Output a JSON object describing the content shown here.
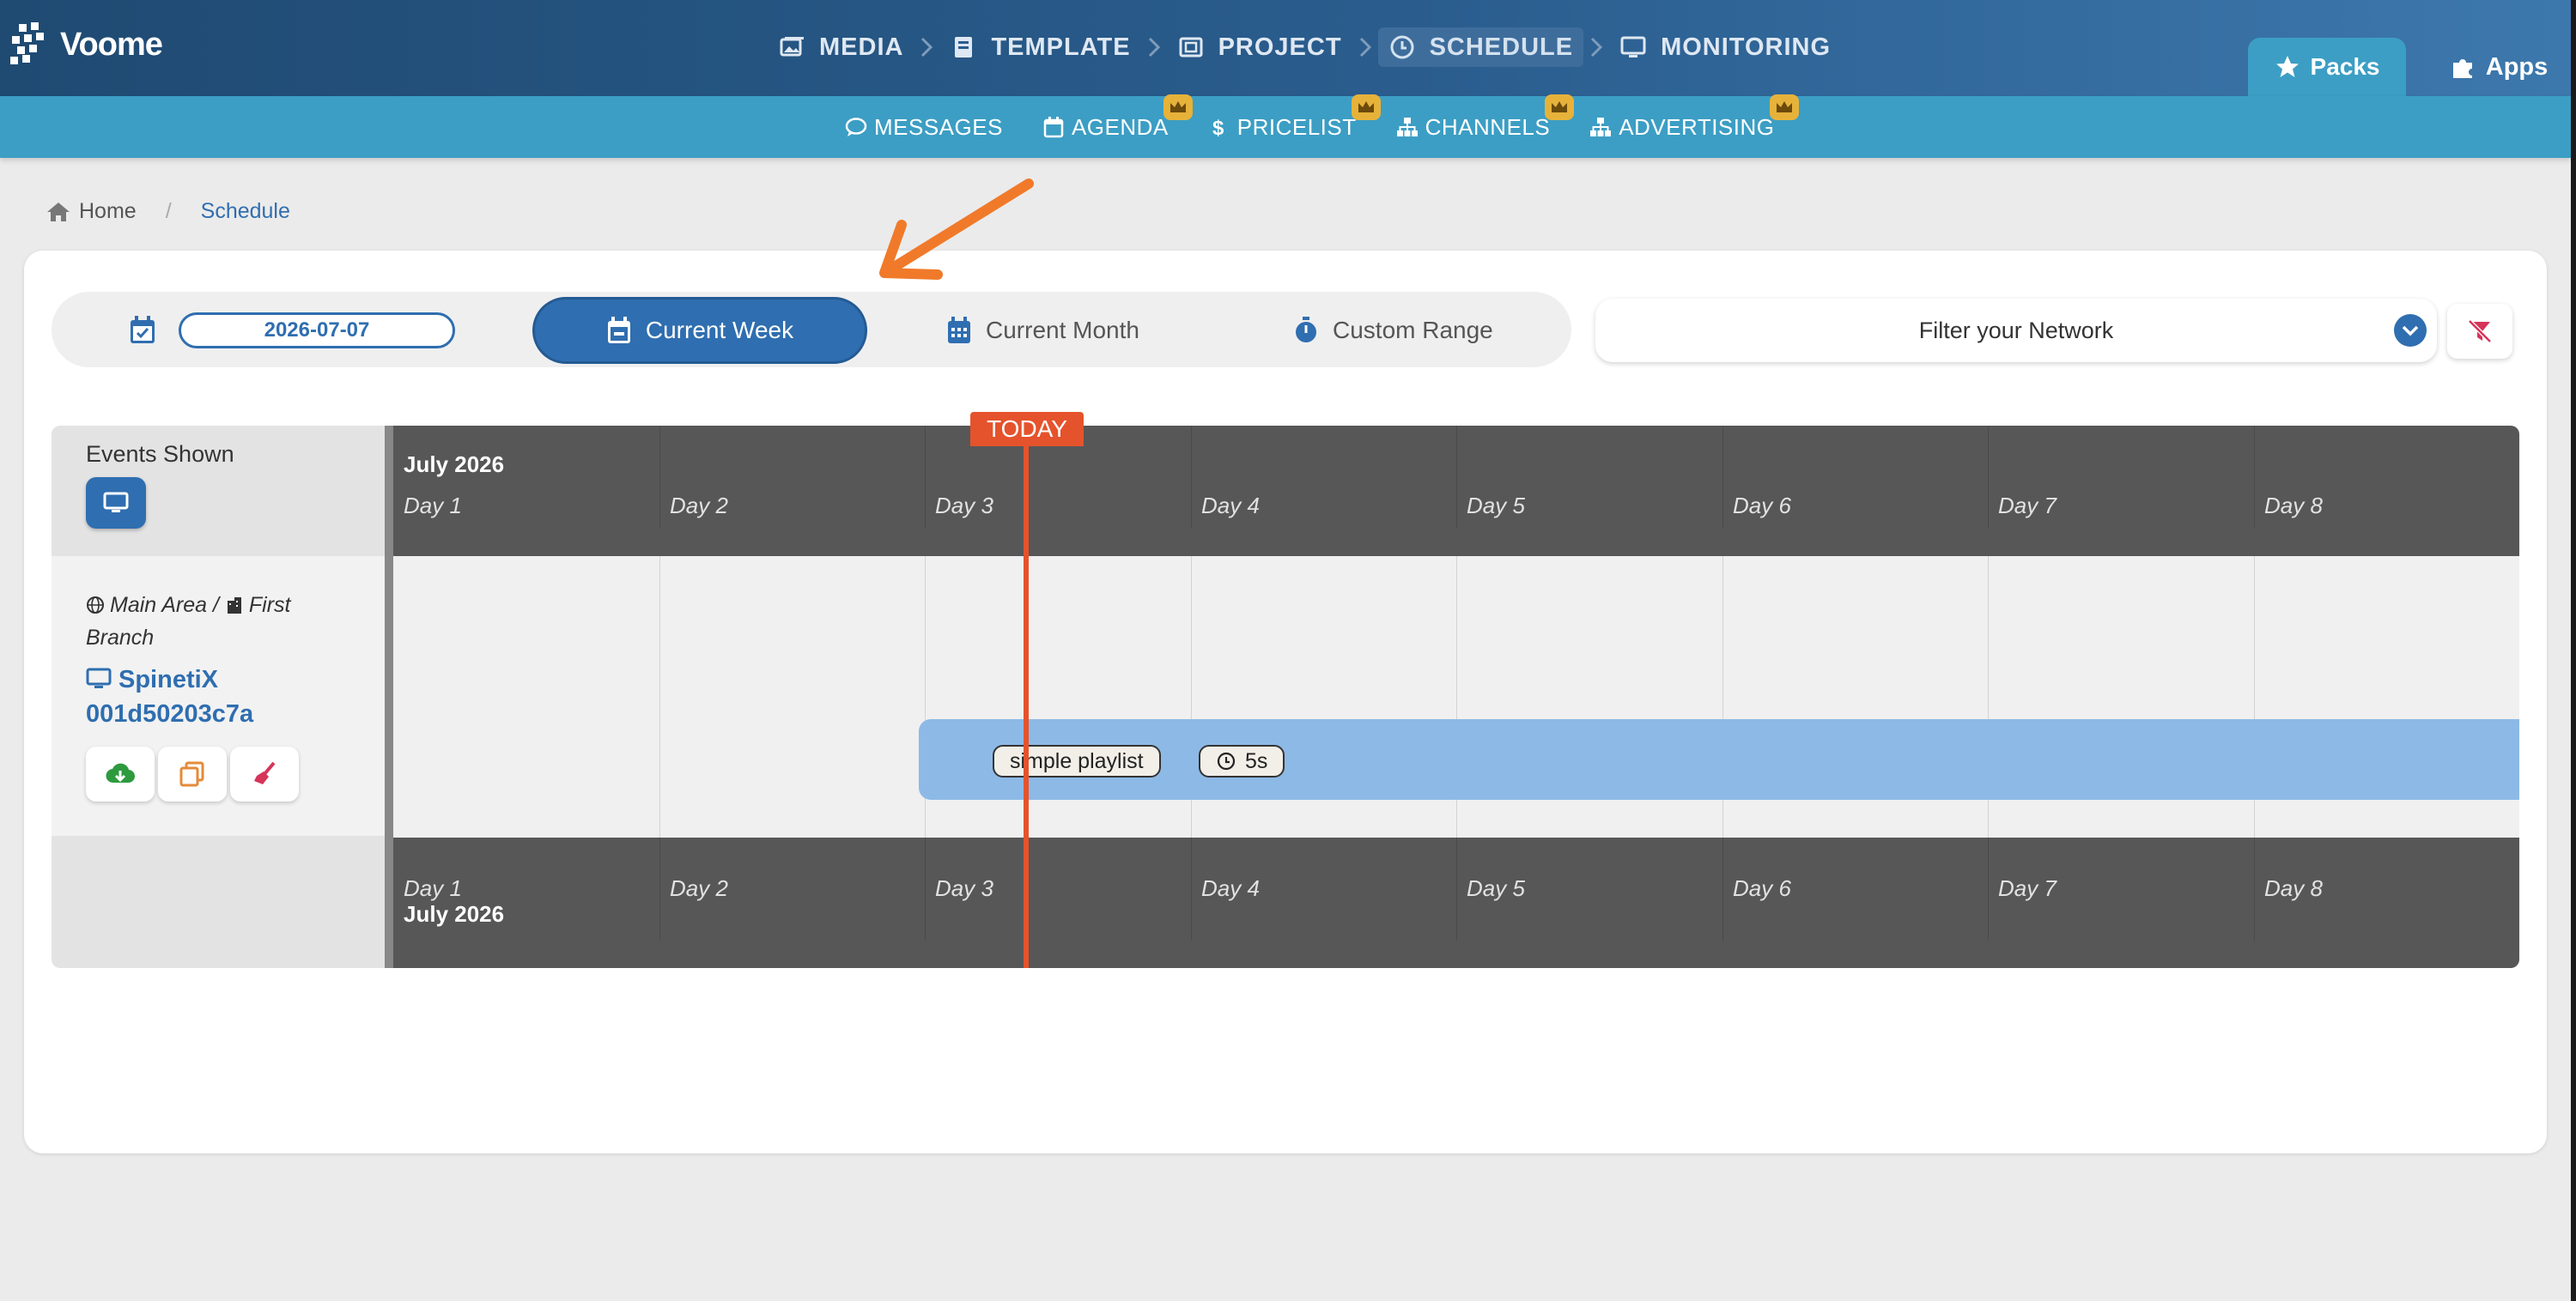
{
  "brand": {
    "name": "Voome"
  },
  "main_nav": [
    {
      "label": "MEDIA",
      "icon": "images-icon"
    },
    {
      "label": "TEMPLATE",
      "icon": "book-icon"
    },
    {
      "label": "PROJECT",
      "icon": "project-icon"
    },
    {
      "label": "SCHEDULE",
      "icon": "clock-icon",
      "active": true
    },
    {
      "label": "MONITORING",
      "icon": "monitor-icon"
    }
  ],
  "top_tabs": {
    "packs": "Packs",
    "apps": "Apps"
  },
  "sub_nav": [
    {
      "label": "MESSAGES",
      "icon": "comment-icon",
      "premium": false
    },
    {
      "label": "AGENDA",
      "icon": "calendar-icon",
      "premium": true
    },
    {
      "label": "PRICELIST",
      "icon": "dollar-icon",
      "premium": true
    },
    {
      "label": "CHANNELS",
      "icon": "sitemap-icon",
      "premium": true
    },
    {
      "label": "ADVERTISING",
      "icon": "sitemap-icon",
      "premium": true
    }
  ],
  "breadcrumb": {
    "home": "Home",
    "current": "Schedule"
  },
  "range": {
    "date_value": "2026-07-07",
    "current_week": "Current Week",
    "current_month": "Current Month",
    "custom_range": "Custom Range",
    "active": "Current Week"
  },
  "filter": {
    "placeholder": "Filter your Network"
  },
  "timeline": {
    "events_shown_label": "Events Shown",
    "month_label": "July 2026",
    "days": [
      "Day 1",
      "Day 2",
      "Day 3",
      "Day 4",
      "Day 5",
      "Day 6",
      "Day 7",
      "Day 8"
    ],
    "today_label": "TODAY",
    "location": {
      "area": "Main Area",
      "separator": "/",
      "branch": "First Branch"
    },
    "device": {
      "line1": "SpinetiX",
      "line2": "001d50203c7a"
    },
    "event": {
      "playlist": "simple playlist",
      "duration": "5s"
    }
  },
  "colors": {
    "accent": "#2f6eb0",
    "subbar": "#3c9ec4",
    "today": "#e5532c",
    "event_bar": "#8db9e6",
    "crown": "#e7b23a"
  }
}
